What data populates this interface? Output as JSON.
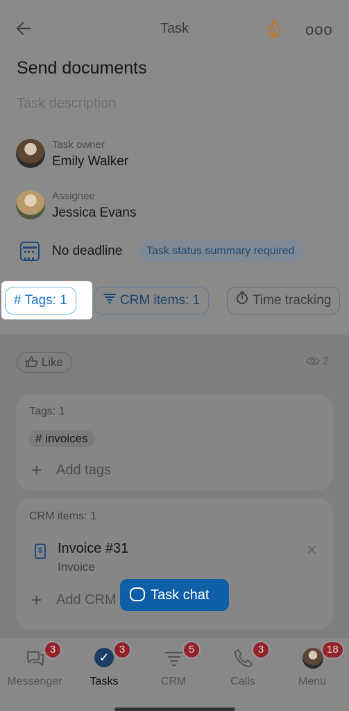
{
  "header": {
    "back_icon": "arrow-left-icon",
    "title": "Task",
    "fire_icon": "fire-icon",
    "more_icon": "more-dots-icon",
    "more_glyph": "ooo"
  },
  "task": {
    "title": "Send documents",
    "description_placeholder": "Task description"
  },
  "owner": {
    "label": "Task owner",
    "name": "Emily Walker"
  },
  "assignee": {
    "label": "Assignee",
    "name": "Jessica Evans"
  },
  "deadline": {
    "icon": "calendar-icon",
    "text": "No deadline",
    "status_pill": "Task status summary required"
  },
  "chips": {
    "tags": "# Tags: 1",
    "crm": "CRM items: 1",
    "time": "Time tracking"
  },
  "social": {
    "like": "Like",
    "views": "2"
  },
  "tags_card": {
    "title": "Tags: 1",
    "tag": "# invoices",
    "add": "Add tags"
  },
  "crm_card": {
    "title": "CRM items: 1",
    "item_name": "Invoice #31",
    "item_type": "Invoice",
    "add": "Add CRM",
    "doc_glyph": "$"
  },
  "task_chat": {
    "label": "Task chat"
  },
  "tabs": [
    {
      "label": "Messenger",
      "badge": "3",
      "icon": "chat-bubbles-icon"
    },
    {
      "label": "Tasks",
      "badge": "3",
      "icon": "check-circle-icon"
    },
    {
      "label": "CRM",
      "badge": "5",
      "icon": "funnel-icon"
    },
    {
      "label": "Calls",
      "badge": "3",
      "icon": "phone-icon"
    },
    {
      "label": "Menu",
      "badge": "18",
      "icon": "avatar"
    }
  ],
  "colors": {
    "accent": "#1a76c8",
    "badge": "#c42f38",
    "primary_button": "#1570d0"
  }
}
